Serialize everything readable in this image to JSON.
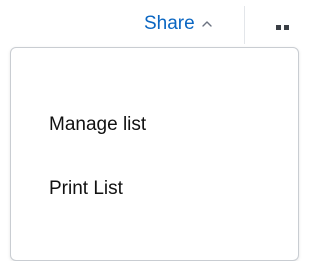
{
  "header": {
    "share_label": "Share",
    "share_icon": "chevron-up-icon",
    "more_icon": "more-options-icon",
    "accent_color": "#0a66c2"
  },
  "menu": {
    "items": [
      {
        "label": "Manage list"
      },
      {
        "label": "Print List"
      }
    ]
  }
}
